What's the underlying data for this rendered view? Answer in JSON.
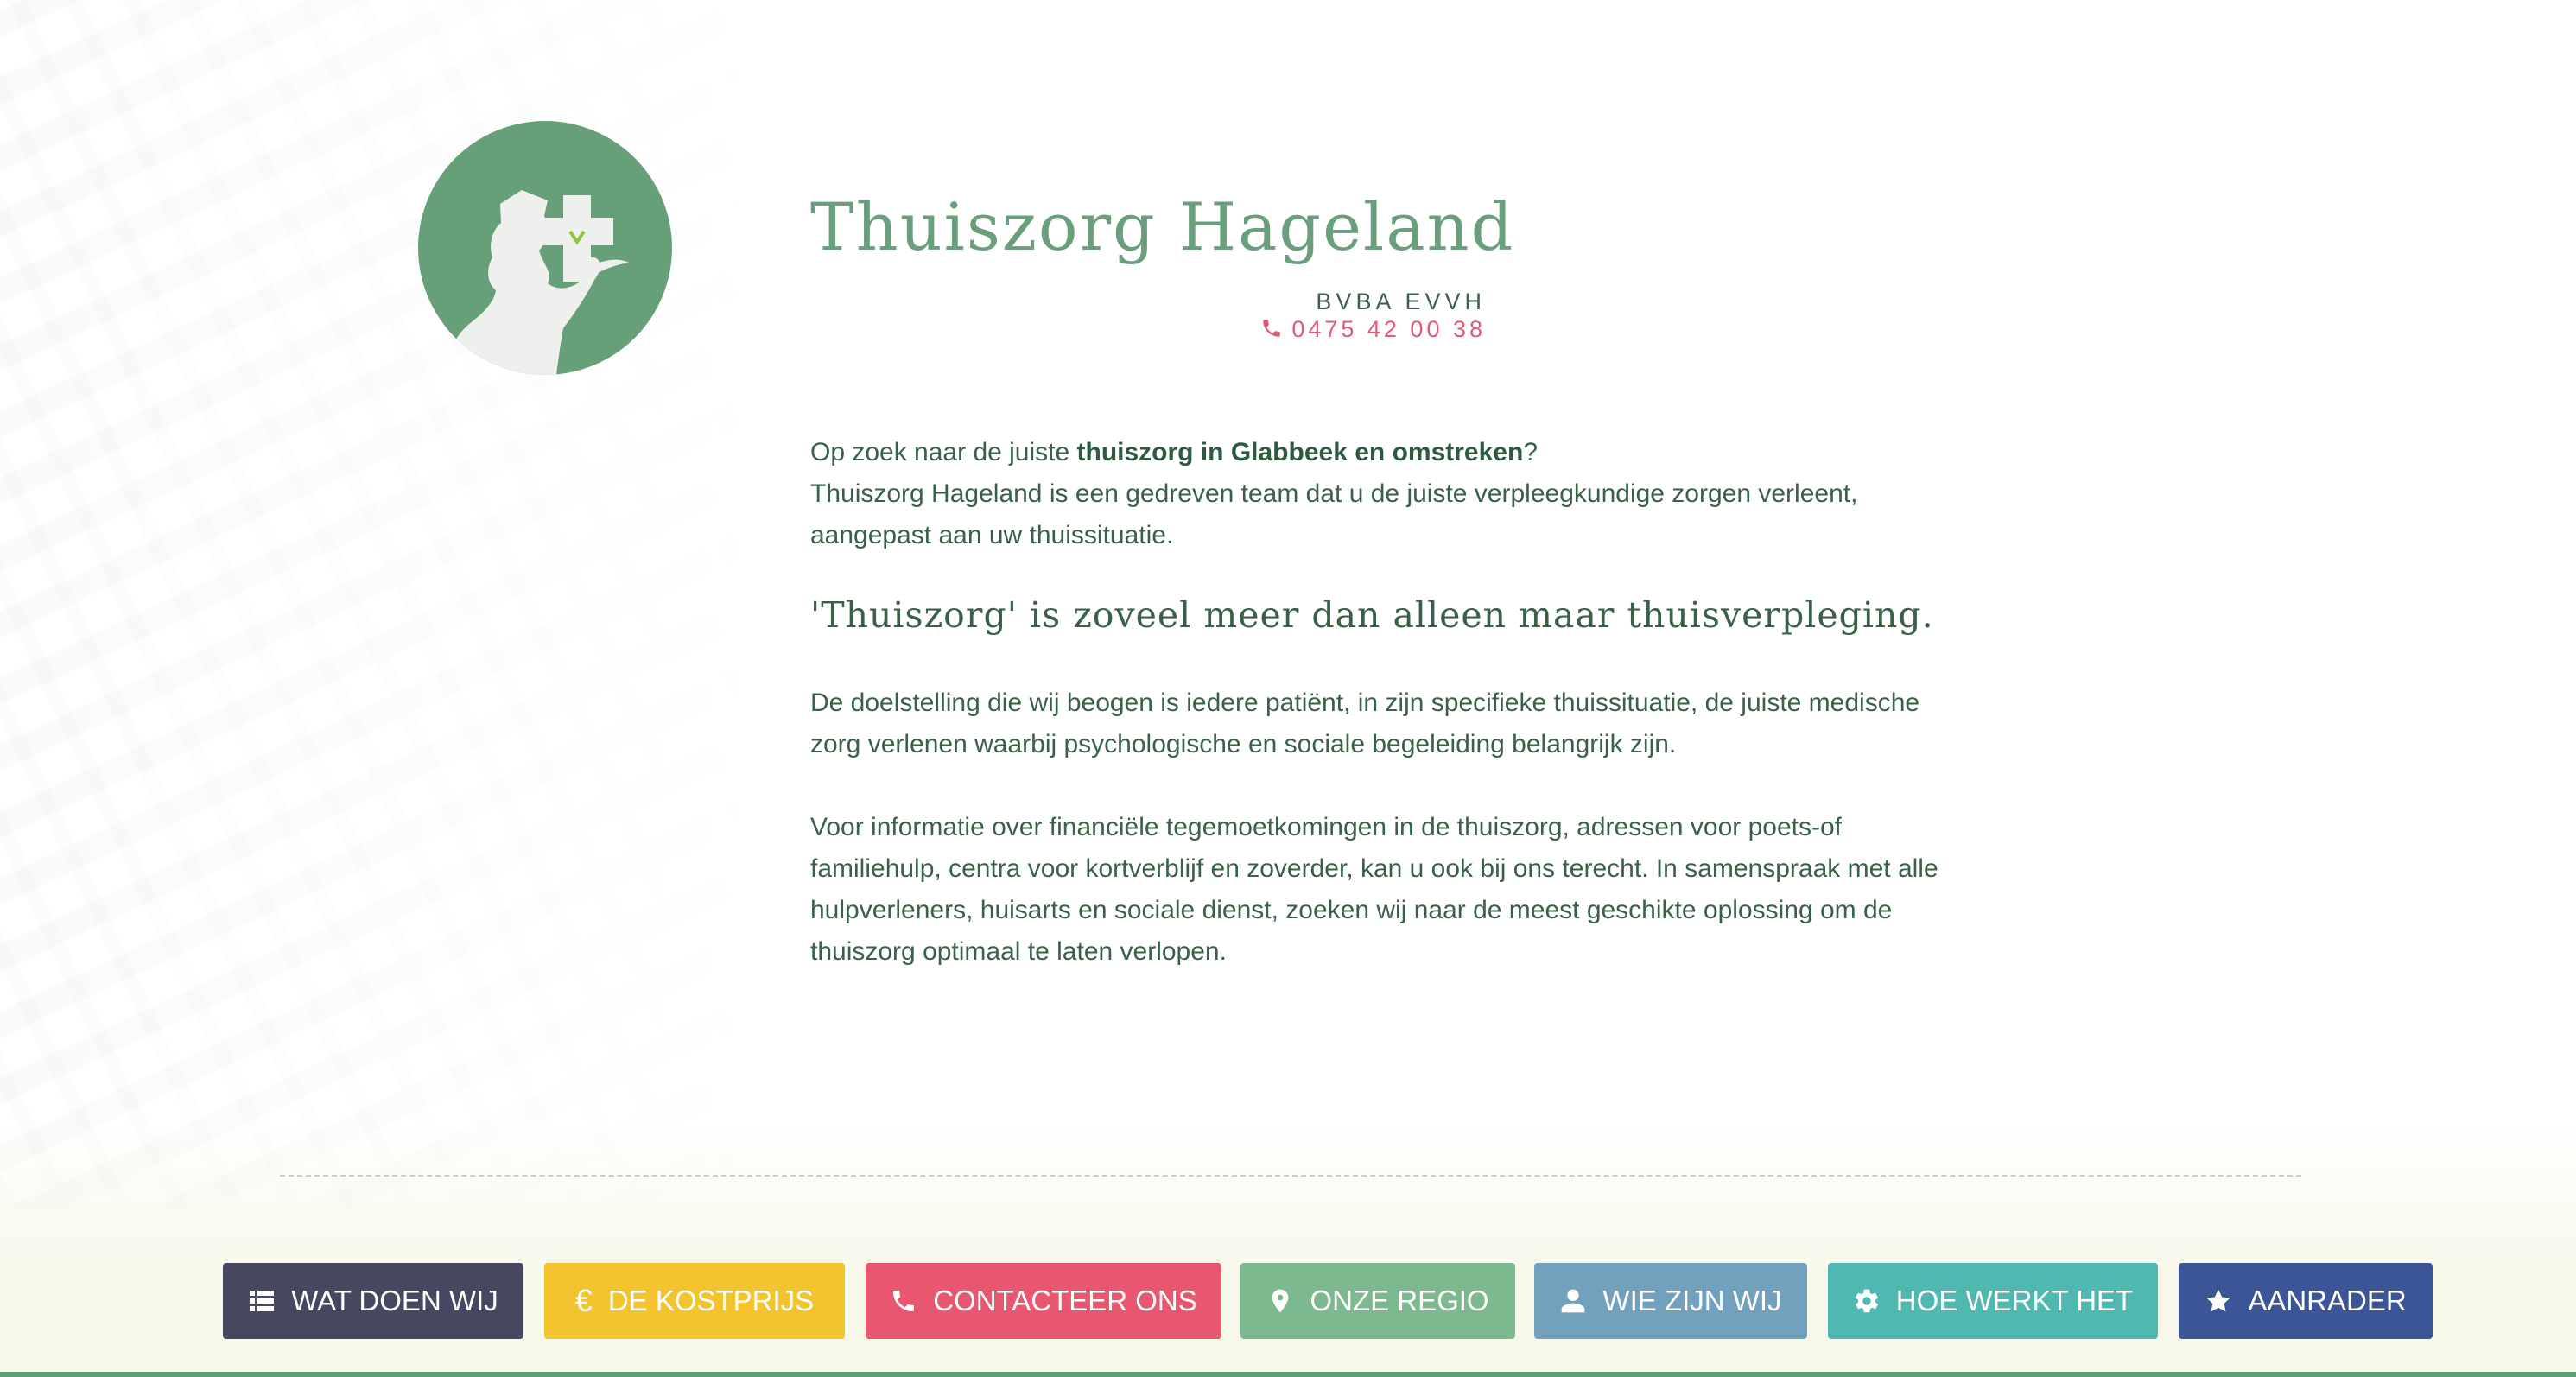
{
  "header": {
    "title": "Thuiszorg Hageland",
    "company": "BVBA EVVH",
    "phone": "0475 42 00 38",
    "logo_icon": "nurse-cross-logo-icon"
  },
  "intro": {
    "line1_prefix": "Op zoek naar de juiste ",
    "line1_bold": "thuiszorg in Glabbeek en omstreken",
    "line1_suffix": "?",
    "line2": "Thuiszorg Hageland is een gedreven team dat u de juiste verpleegkundige zorgen verleent, aangepast aan uw thuissituatie."
  },
  "tagline": "'Thuiszorg' is zoveel meer dan alleen maar thuisverpleging.",
  "paragraphs": [
    "De doelstelling die wij beogen is iedere patiënt, in zijn specifieke thuissituatie, de juiste medische zorg verlenen waarbij psychologische en sociale begeleiding belangrijk zijn.",
    "Voor informatie over financiële tegemoetkomingen in de thuiszorg, adressen voor poets-of familiehulp, centra voor kortverblijf en zoverder, kan u ook bij ons terecht. In samenspraak met alle hulpverleners, huisarts en sociale dienst, zoeken wij naar de meest geschikte oplossing om de thuiszorg optimaal te laten verlopen."
  ],
  "nav": [
    {
      "label": "WAT DOEN WIJ",
      "icon": "list-icon",
      "color": "#474761"
    },
    {
      "label": "DE KOSTPRIJS",
      "icon": "euro-icon",
      "color": "#f4c430"
    },
    {
      "label": "CONTACTEER ONS",
      "icon": "phone-icon",
      "color": "#e8566f"
    },
    {
      "label": "ONZE REGIO",
      "icon": "map-pin-icon",
      "color": "#7db98e"
    },
    {
      "label": "WIE ZIJN WIJ",
      "icon": "user-icon",
      "color": "#71a1bd"
    },
    {
      "label": "HOE WERKT HET",
      "icon": "gear-icon",
      "color": "#4fb8b0"
    },
    {
      "label": "AANRADER",
      "icon": "star-icon",
      "color": "#3c5596"
    }
  ],
  "colors": {
    "title_green": "#6a9f7d",
    "text_green": "#3a6148",
    "phone_pink": "#e05b77",
    "footer_band": "#5e9f78"
  }
}
